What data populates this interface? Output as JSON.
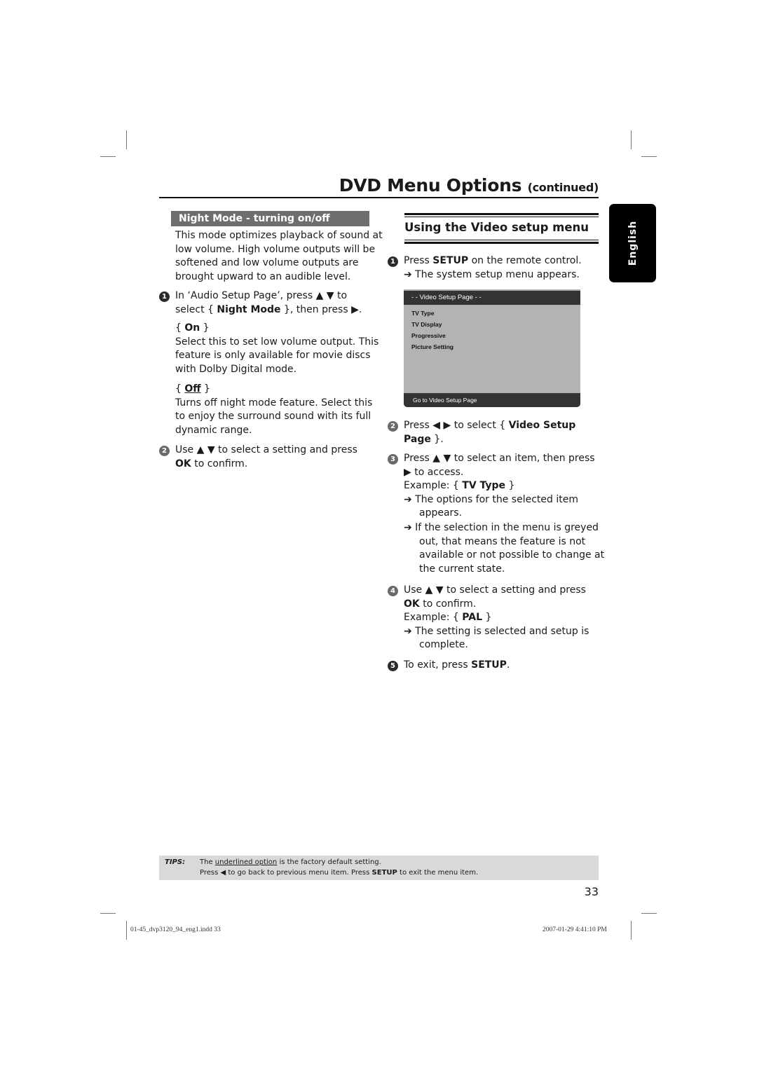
{
  "header": {
    "title": "DVD Menu Options",
    "title_suffix": "(continued)"
  },
  "language_tab": "English",
  "left_section": {
    "heading": "Night Mode - turning on/off",
    "intro": [
      "This mode optimizes playback of sound at",
      "low volume. High volume outputs will be",
      "softened and low volume outputs are",
      "brought upward to an audible level."
    ],
    "step1": {
      "number": "1",
      "line1_a": "In ‘Audio Setup Page’, press ▲ ▼ to",
      "line2_a": "select { ",
      "line2_bold": "Night Mode",
      "line2_b": " }, then press ▶."
    },
    "option_on": {
      "label_open": "{ ",
      "label": "On",
      "label_close": " }",
      "desc": [
        "Select this to set low volume output. This",
        "feature is only available for movie discs",
        "with Dolby Digital mode."
      ]
    },
    "option_off": {
      "label_open": "{ ",
      "label": "Off",
      "label_close": " }",
      "desc": [
        "Turns off night mode feature. Select this",
        "to enjoy the surround sound with its full",
        "dynamic range."
      ]
    },
    "step2": {
      "number": "2",
      "line1": "Use ▲ ▼ to select a setting and press",
      "line2_bold": "OK",
      "line2_rest": " to confirm."
    }
  },
  "right_section": {
    "heading": "Using the Video setup menu",
    "step1": {
      "number": "1",
      "a": "Press ",
      "bold": "SETUP",
      "b": " on the remote control.",
      "result": "➔ The system setup menu appears."
    },
    "menu_screenshot": {
      "header": "- -  Video Setup Page  - -",
      "items": [
        "TV Type",
        "TV Display",
        "Progressive",
        "Picture Setting"
      ],
      "footer": "Go to Video Setup Page"
    },
    "step2": {
      "number": "2",
      "a": "Press ◀ ▶ to select { ",
      "bold1": "Video Setup",
      "bold2": "Page",
      "b": " }."
    },
    "step3": {
      "number": "3",
      "line1": "Press ▲ ▼ to select an item, then press",
      "line2": "▶ to access.",
      "example_a": "Example: { ",
      "example_bold": "TV Type",
      "example_b": " }",
      "result1": [
        "➔ The options for the selected item",
        "appears."
      ],
      "result2": [
        "➔ If the selection in the menu is greyed",
        "out, that means the feature is not",
        "available or not possible to change at",
        "the current state."
      ]
    },
    "step4": {
      "number": "4",
      "line1": "Use ▲ ▼ to select a setting and press",
      "line2_bold": "OK",
      "line2_rest": " to confirm.",
      "example_a": "Example: { ",
      "example_bold": "PAL",
      "example_b": " }",
      "result": [
        "➔ The setting is selected and setup is",
        "complete."
      ]
    },
    "step5": {
      "number": "5",
      "a": "To exit, press ",
      "bold": "SETUP",
      "b": "."
    }
  },
  "tips": {
    "label": "TIPS:",
    "line1_a": "The ",
    "line1_underlined": "underlined option",
    "line1_b": " is the factory default setting.",
    "line2_a": "Press ◀ to go back to previous menu item. Press ",
    "line2_bold": "SETUP",
    "line2_b": " to exit the menu item."
  },
  "page_number": "33",
  "slug": {
    "file": "01-45_dvp3120_94_eng1.indd   33",
    "timestamp": "2007-01-29   4:41:10 PM"
  }
}
